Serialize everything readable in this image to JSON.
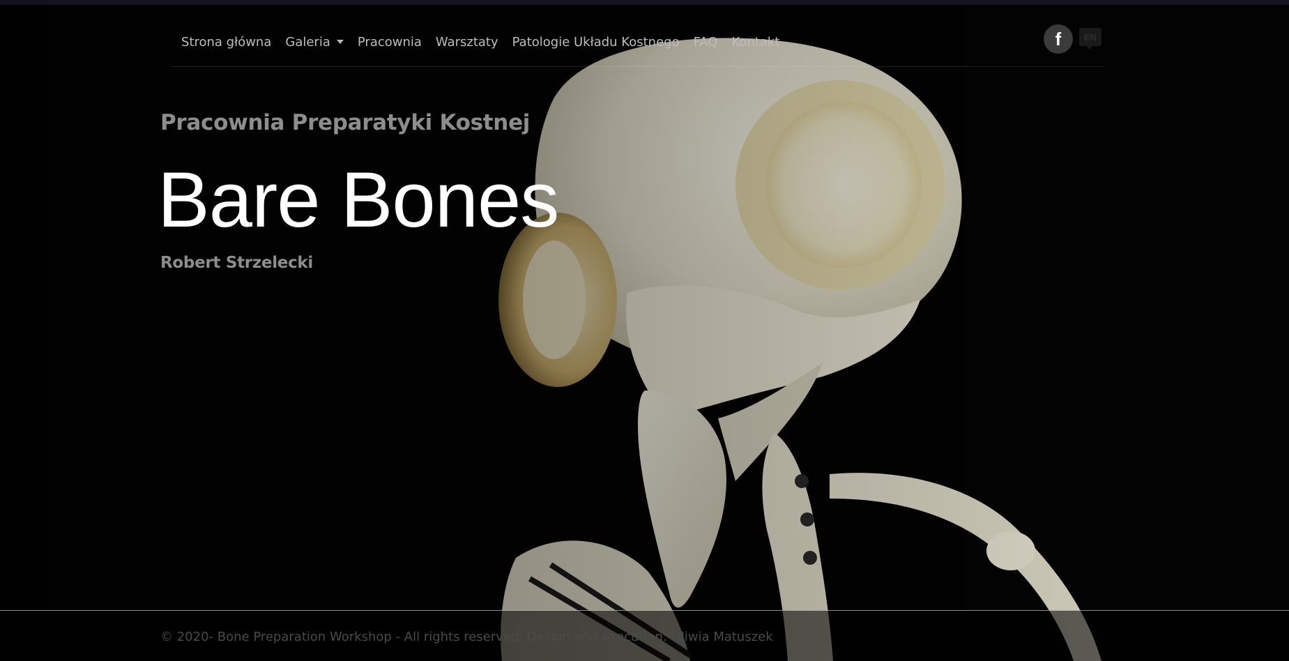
{
  "nav": {
    "items": [
      {
        "label": "Strona główna"
      },
      {
        "label": "Galeria"
      },
      {
        "label": "Pracownia"
      },
      {
        "label": "Warsztaty"
      },
      {
        "label": "Patologie Układu Kostnego"
      },
      {
        "label": "FAQ"
      },
      {
        "label": "Kontakt"
      }
    ],
    "facebook_icon": "facebook-icon",
    "facebook_letter": "f",
    "language_icon": "speech-bubble-icon",
    "language_label": "EN"
  },
  "hero": {
    "subtitle": "Pracownia Preparatyki Kostnej",
    "title": "Bare Bones",
    "author": "Robert Strzelecki",
    "background_image": "bird-skeleton-skull-photo"
  },
  "footer": {
    "text": "© 2020- Bone Preparation Workshop - All rights reserved. Design and execution: Oliwia Matuszek"
  },
  "colors": {
    "background": "#030303",
    "nav_text": "#bdbdbd",
    "subtitle_text": "#8d8d8d",
    "title_text": "#ffffff",
    "bone": "#ece9d8"
  }
}
